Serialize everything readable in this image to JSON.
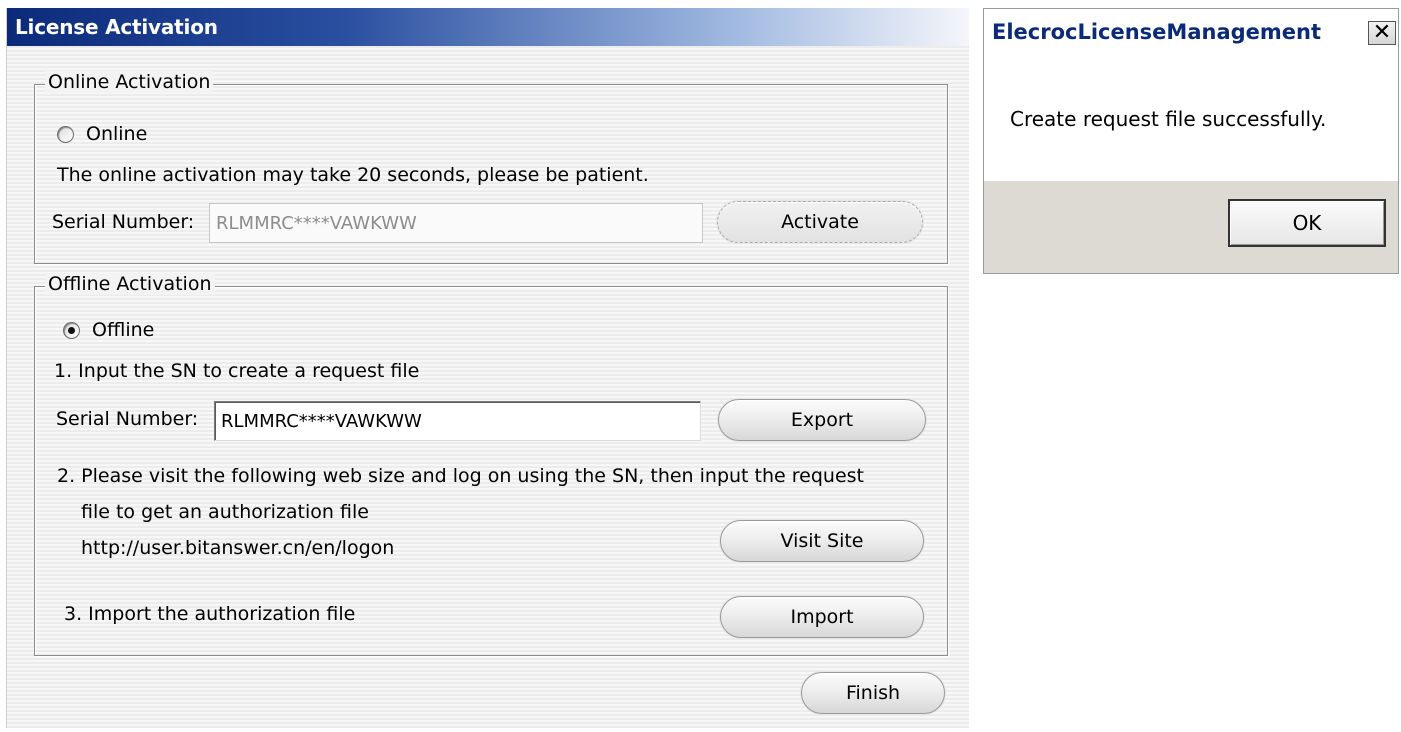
{
  "main_window": {
    "title": "License Activation",
    "online": {
      "group_label": "Online Activation",
      "radio_label": "Online",
      "radio_checked": false,
      "note": "The online activation may take 20 seconds, please be patient.",
      "serial_label": "Serial Number:",
      "serial_value": "RLMMRC****VAWKWW",
      "activate_label": "Activate"
    },
    "offline": {
      "group_label": "Offline Activation",
      "radio_label": "Offline",
      "radio_checked": true,
      "step1": "1. Input the SN to create a request file",
      "serial_label": "Serial Number:",
      "serial_value": "RLMMRC****VAWKWW",
      "export_label": "Export",
      "step2_line1": "2. Please visit the following web size and log on using the SN, then input the request",
      "step2_line2": "file to get an authorization file",
      "url": "http://user.bitanswer.cn/en/logon",
      "visit_label": "Visit Site",
      "step3": "3. Import the authorization file",
      "import_label": "Import"
    },
    "finish_label": "Finish"
  },
  "message_box": {
    "title": "ElecrocLicenseManagement",
    "close_glyph": "✕",
    "message": "Create request file successfully.",
    "ok_label": "OK"
  }
}
